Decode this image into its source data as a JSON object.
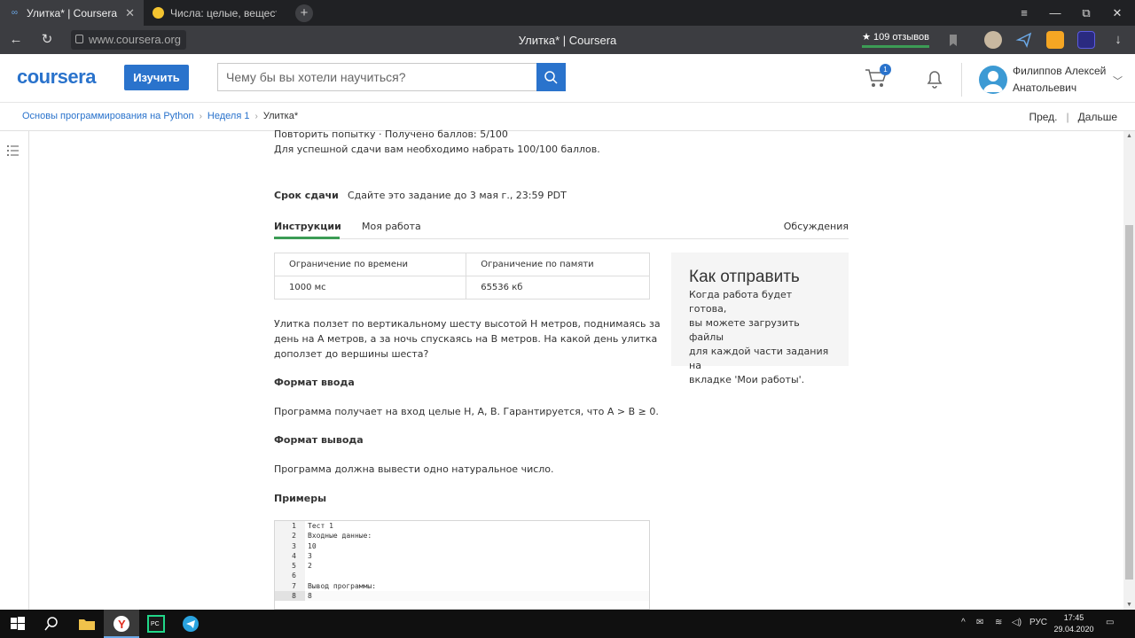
{
  "browser": {
    "tabs": [
      {
        "title": "Улитка* | Coursera",
        "active": true
      },
      {
        "title": "Числа: целые, веществен",
        "active": false
      }
    ],
    "url": "www.coursera.org",
    "page_title": "Улитка* | Coursera",
    "reviews": "★ 109 отзывов"
  },
  "header": {
    "logo": "coursera",
    "explore_label": "Изучить",
    "search_placeholder": "Чему бы вы хотели научиться?",
    "cart_count": "1",
    "user_line1": "Филиппов Алексей",
    "user_line2": "Анатольевич"
  },
  "breadcrumb": {
    "items": [
      "Основы программирования на Python",
      "Неделя 1",
      "Улитка*"
    ],
    "prev": "Пред.",
    "next": "Дальше"
  },
  "assignment": {
    "retry_line": "Повторить попытку · Получено баллов: 5/100",
    "pass_req": "Для успешной сдачи вам необходимо набрать 100/100 баллов.",
    "deadline_label": "Срок сдачи",
    "deadline_value": "Сдайте это задание до 3 мая г., 23:59 PDT",
    "tabs": [
      "Инструкции",
      "Моя работа"
    ],
    "discussions": "Обсуждения",
    "limits": {
      "time_header": "Ограничение по времени",
      "mem_header": "Ограничение по памяти",
      "time_value": "1000 мс",
      "mem_value": "65536 кб"
    },
    "statement_lines": [
      "Улитка ползет по вертикальному шесту высотой H метров, поднимаясь за",
      "день на A метров, а за ночь спускаясь на B метров. На какой день улитка",
      "доползет до вершины шеста?"
    ],
    "input_heading": "Формат ввода",
    "input_text": "Программа получает на вход целые H, A, B. Гарантируется, что A > B ≥ 0.",
    "output_heading": "Формат вывода",
    "output_text": "Программа должна вывести одно натуральное число.",
    "examples_heading": "Примеры",
    "code_lines": [
      {
        "n": "1",
        "t": "Тест 1"
      },
      {
        "n": "2",
        "t": "Входные данные:"
      },
      {
        "n": "3",
        "t": "10"
      },
      {
        "n": "4",
        "t": "3"
      },
      {
        "n": "5",
        "t": "2"
      },
      {
        "n": "6",
        "t": ""
      },
      {
        "n": "7",
        "t": "Вывод программы:"
      },
      {
        "n": "8",
        "t": "8"
      }
    ],
    "submit_box": {
      "title": "Как отправить",
      "lines": [
        "Когда работа будет готова,",
        "вы можете загрузить файлы",
        "для каждой части задания на",
        "вкладке 'Мои работы'."
      ]
    }
  },
  "taskbar": {
    "lang": "РУС",
    "time": "17:45",
    "date": "29.04.2020"
  },
  "colors": {
    "brand": "#2a73cc",
    "tab_active_underline": "#3c9c55"
  }
}
